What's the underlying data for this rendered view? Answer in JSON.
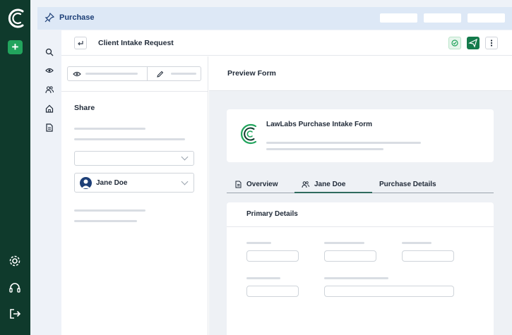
{
  "topbar": {
    "title": "Purchase"
  },
  "header": {
    "title": "Client Intake Request"
  },
  "share": {
    "label": "Share",
    "assignee": "Jane Doe"
  },
  "preview": {
    "title": "Preview Form"
  },
  "form": {
    "title": "LawLabs Purchase Intake Form"
  },
  "tabs": [
    {
      "label": "Overview",
      "icon": "document-icon"
    },
    {
      "label": "Jane Doe",
      "icon": "users-icon"
    },
    {
      "label": "Purchase Details"
    }
  ],
  "section": {
    "title": "Primary Details"
  },
  "colors": {
    "brand": "#0f3a2c",
    "accent": "#22a45d",
    "topbar": "#dde8f6",
    "link": "#1d3f77"
  }
}
